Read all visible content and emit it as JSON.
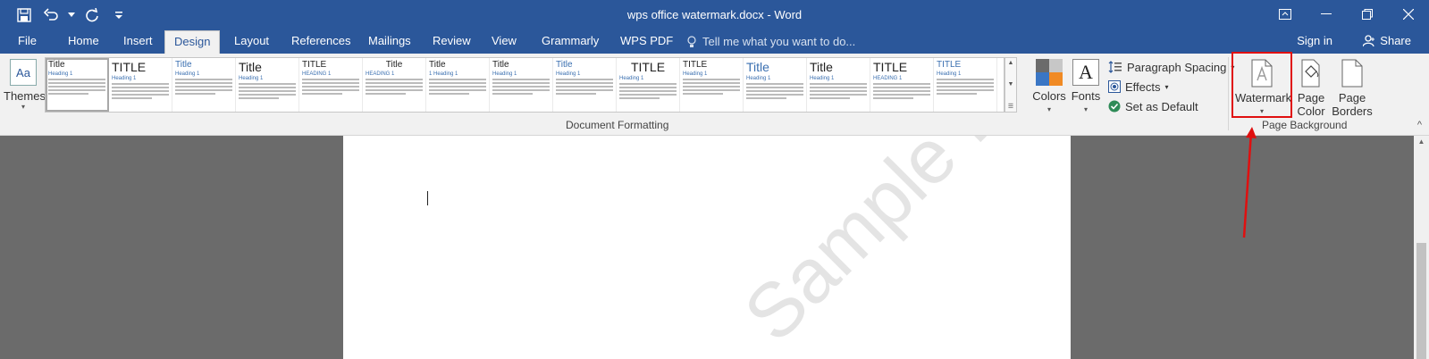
{
  "window": {
    "title": "wps office watermark.docx - Word",
    "quick_access": [
      "save-icon",
      "undo-icon",
      "undo-dropdown-icon",
      "redo-icon",
      "customize-qat-icon"
    ]
  },
  "tabs": [
    {
      "label": "File"
    },
    {
      "label": "Home"
    },
    {
      "label": "Insert"
    },
    {
      "label": "Design"
    },
    {
      "label": "Layout"
    },
    {
      "label": "References"
    },
    {
      "label": "Mailings"
    },
    {
      "label": "Review"
    },
    {
      "label": "View"
    },
    {
      "label": "Grammarly"
    },
    {
      "label": "WPS PDF"
    }
  ],
  "tellme": {
    "placeholder": "Tell me what you want to do..."
  },
  "account": {
    "signin": "Sign in",
    "share": "Share"
  },
  "ribbon": {
    "themes_label": "Themes",
    "themes_icon_text": "Aa",
    "gallery": [
      {
        "title": "Title",
        "heading": "Heading 1"
      },
      {
        "title": "TITLE",
        "heading": "Heading 1"
      },
      {
        "title": "Title",
        "heading": "Heading 1"
      },
      {
        "title": "Title",
        "heading": "Heading 1"
      },
      {
        "title": "TITLE",
        "heading": "HEADING 1"
      },
      {
        "title": "Title",
        "heading": "HEADING 1"
      },
      {
        "title": "Title",
        "heading": "1 Heading 1"
      },
      {
        "title": "Title",
        "heading": "Heading 1"
      },
      {
        "title": "Title",
        "heading": "Heading 1"
      },
      {
        "title": "TITLE",
        "heading": "Heading 1"
      },
      {
        "title": "TITLE",
        "heading": "Heading 1"
      },
      {
        "title": "Title",
        "heading": "Heading 1"
      },
      {
        "title": "Title",
        "heading": "Heading 1"
      },
      {
        "title": "TITLE",
        "heading": "HEADING 1"
      },
      {
        "title": "TITLE",
        "heading": "Heading 1"
      }
    ],
    "colors_label": "Colors",
    "fonts_label": "Fonts",
    "fonts_icon_text": "A",
    "paragraph_spacing": "Paragraph Spacing",
    "effects": "Effects",
    "set_default": "Set as Default",
    "document_formatting_label": "Document Formatting",
    "watermark_label": "Watermark",
    "page_color_label": "Page Color",
    "page_borders_label": "Page Borders",
    "page_background_label": "Page Background"
  },
  "document": {
    "watermark_text": "Sample Doc"
  },
  "colors": {
    "accent": "#2b579a",
    "highlight": "#e01010",
    "palette": [
      "#6b6b6b",
      "#c7c7c7",
      "#3a76c4",
      "#f08a24"
    ]
  }
}
